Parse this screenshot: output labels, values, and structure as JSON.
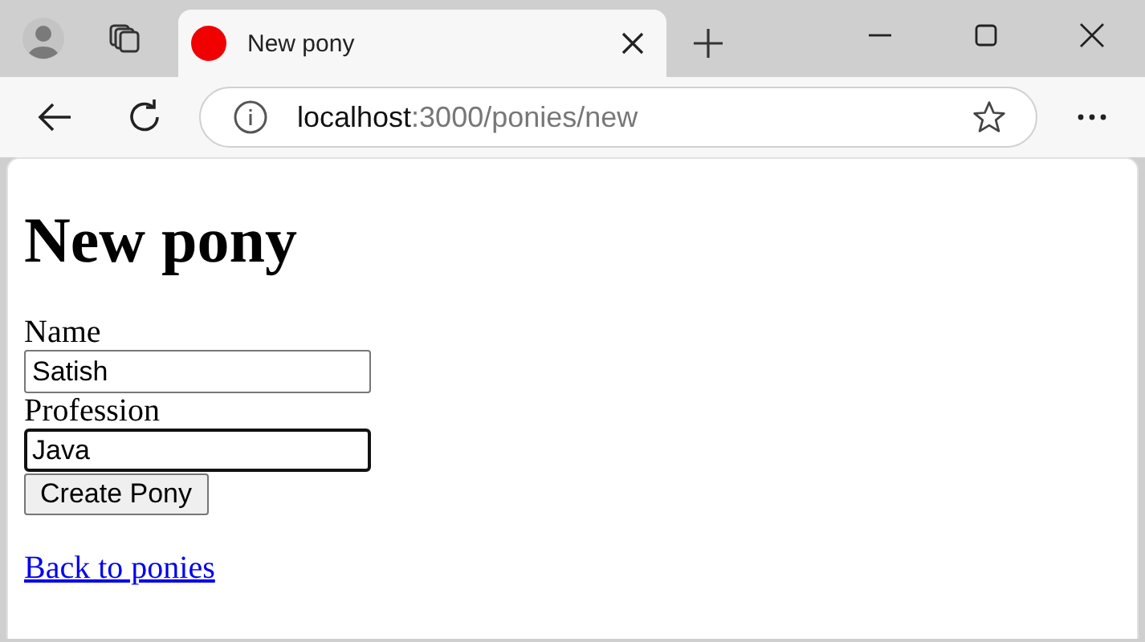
{
  "tab": {
    "title": "New pony",
    "selected": true
  },
  "address_bar": {
    "host": "localhost",
    "path": ":3000/ponies/new"
  },
  "page": {
    "heading": "New pony",
    "fields": [
      {
        "label": "Name",
        "value": "Satish",
        "focused": false
      },
      {
        "label": "Profession",
        "value": "Java",
        "focused": true
      }
    ],
    "submit": "Create Pony",
    "link": "Back to ponies"
  }
}
